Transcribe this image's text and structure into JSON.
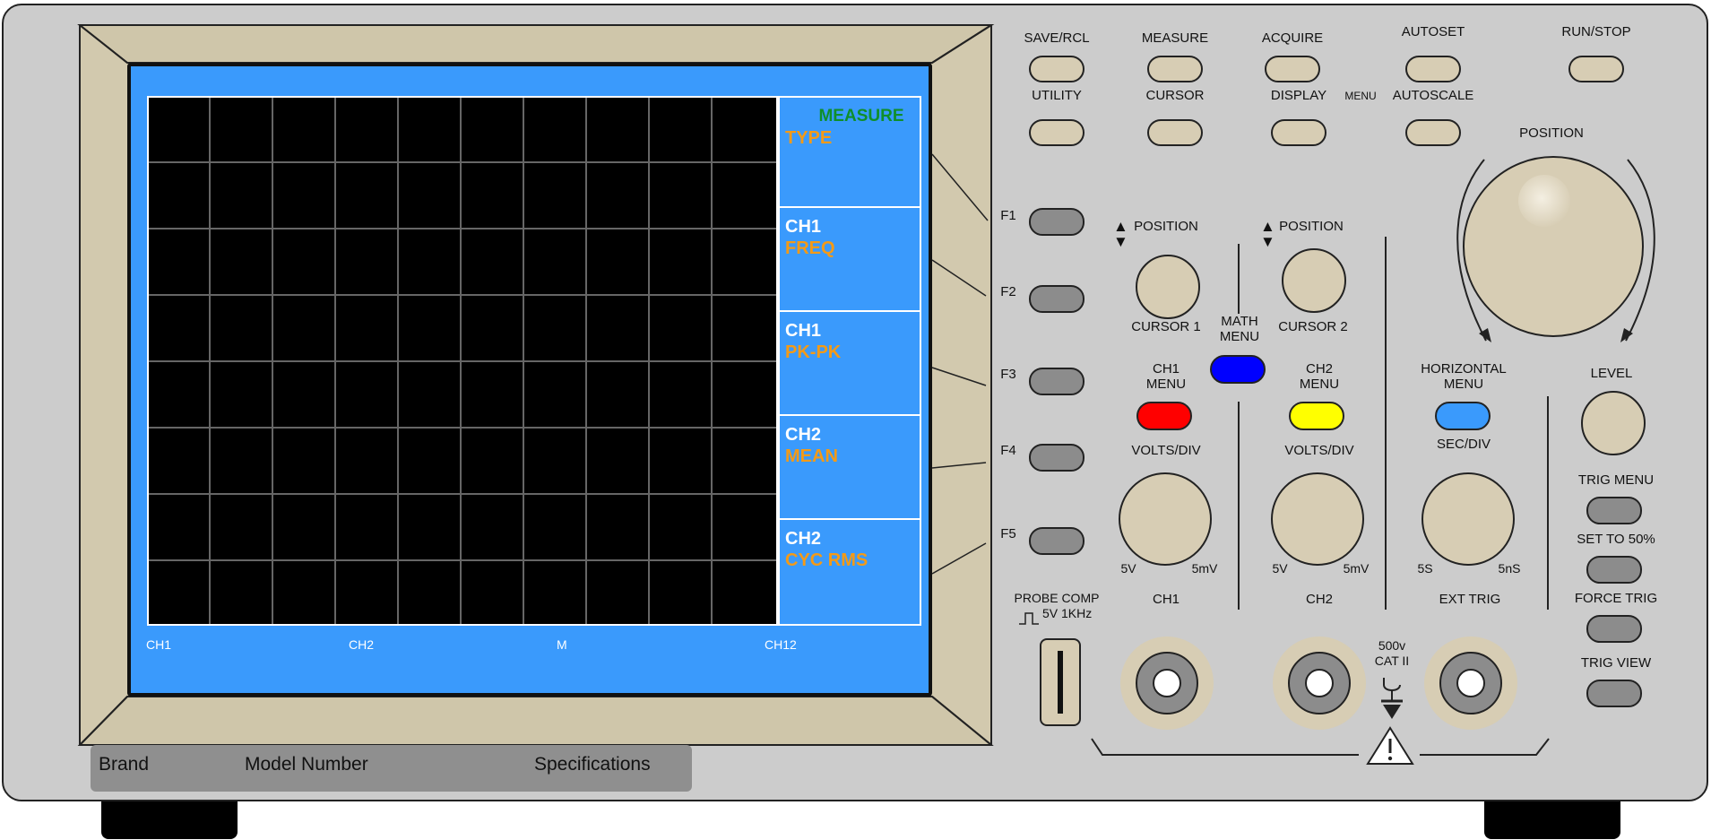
{
  "colors": {
    "body": "#cccccc",
    "bezel": "#d2c9ae",
    "screen_blue": "#3a9afc",
    "grid_bg": "#000000",
    "grid_line": "#666666",
    "accent_orange": "#f49a16",
    "measure_green": "#0f8f2a",
    "button_beige": "#d7cdb4",
    "button_grey": "#8c8c8c",
    "ch1_red": "#ff0000",
    "ch2_yellow": "#ffff00",
    "math_blue": "#0000ff",
    "horiz_blue": "#3a9afc"
  },
  "screen": {
    "menu_title": "MEASURE",
    "menu_items": [
      {
        "top": "",
        "bottom": "TYPE"
      },
      {
        "top": "CH1",
        "bottom": "FREQ"
      },
      {
        "top": "CH1",
        "bottom": "PK-PK"
      },
      {
        "top": "CH2",
        "bottom": "MEAN"
      },
      {
        "top": "CH2",
        "bottom": "CYC RMS"
      }
    ],
    "status": [
      "CH1",
      "CH2",
      "M",
      "CH12"
    ]
  },
  "label_bar": {
    "brand": "Brand",
    "model": "Model Number",
    "specs": "Specifications"
  },
  "top_buttons": {
    "save_rcl": "SAVE/RCL",
    "measure": "MEASURE",
    "acquire": "ACQUIRE",
    "autoset": "AUTOSET",
    "run_stop": "RUN/STOP",
    "utility": "UTILITY",
    "cursor": "CURSOR",
    "display": "DISPLAY",
    "menu": "MENU",
    "autoscale": "AUTOSCALE"
  },
  "fkeys": [
    "F1",
    "F2",
    "F3",
    "F4",
    "F5"
  ],
  "vertical": {
    "position": "POSITION",
    "cursor1": "CURSOR 1",
    "cursor2": "CURSOR 2",
    "math_menu": "MATH\nMENU",
    "ch1_menu": "CH1\nMENU",
    "ch2_menu": "CH2\nMENU",
    "volts_div": "VOLTS/DIV",
    "v_max": "5V",
    "v_min": "5mV",
    "ch1": "CH1",
    "ch2": "CH2"
  },
  "horizontal": {
    "position": "POSITION",
    "menu": "HORIZONTAL\nMENU",
    "sec_div": "SEC/DIV",
    "s_max": "5S",
    "s_min": "5nS",
    "ext_trig": "EXT TRIG"
  },
  "trigger": {
    "level": "LEVEL",
    "trig_menu": "TRIG MENU",
    "set_50": "SET TO 50%",
    "force_trig": "FORCE TRIG",
    "trig_view": "TRIG VIEW"
  },
  "probe": {
    "label": "PROBE COMP",
    "spec": "5V 1KHz"
  },
  "warning": {
    "rating": "500v",
    "category": "CAT II"
  },
  "icons": {
    "arrow_up_down": "▲▼",
    "square_wave": "square-wave-icon",
    "warning": "warning-triangle-icon",
    "ground": "ground-icon"
  }
}
